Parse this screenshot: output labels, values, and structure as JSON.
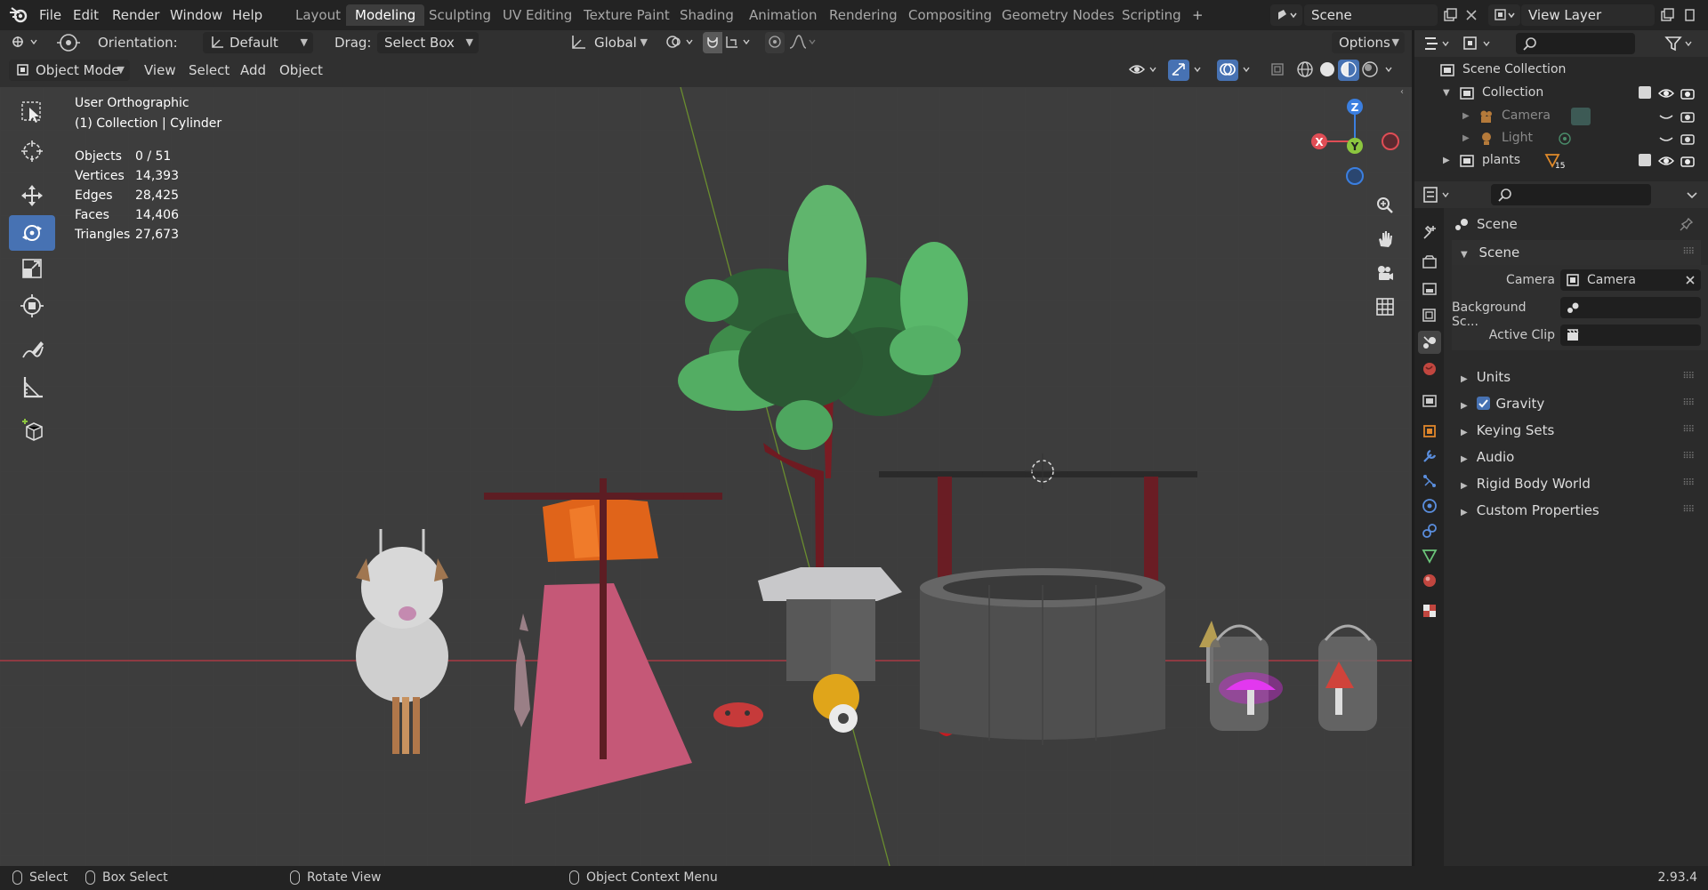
{
  "menu": {
    "file": "File",
    "edit": "Edit",
    "render": "Render",
    "window": "Window",
    "help": "Help"
  },
  "workspaces": [
    "Layout",
    "Modeling",
    "Sculpting",
    "UV Editing",
    "Texture Paint",
    "Shading",
    "Animation",
    "Rendering",
    "Compositing",
    "Geometry Nodes",
    "Scripting"
  ],
  "active_workspace": "Modeling",
  "add_workspace": "+",
  "scene_field": "Scene",
  "view_layer_field": "View Layer",
  "header": {
    "orientation_label": "Orientation:",
    "orientation_value": "Default",
    "drag_label": "Drag:",
    "drag_value": "Select Box",
    "transform_orientation": "Global",
    "options": "Options",
    "mode": "Object Mode",
    "view": "View",
    "select": "Select",
    "add": "Add",
    "object": "Object"
  },
  "overlay_text": {
    "view_name": "User Orthographic",
    "collection_info": "(1) Collection | Cylinder",
    "stats": [
      {
        "label": "Objects",
        "value": "0 / 51"
      },
      {
        "label": "Vertices",
        "value": "14,393"
      },
      {
        "label": "Edges",
        "value": "28,425"
      },
      {
        "label": "Faces",
        "value": "14,406"
      },
      {
        "label": "Triangles",
        "value": "27,673"
      }
    ]
  },
  "gizmo": {
    "z": "Z",
    "y": "Y",
    "x": "X"
  },
  "outliner": {
    "scene_collection": "Scene Collection",
    "items": [
      {
        "name": "Collection"
      },
      {
        "name": "Camera"
      },
      {
        "name": "Light"
      },
      {
        "name": "plants",
        "badge": "15"
      }
    ]
  },
  "properties": {
    "scene_header": "Scene",
    "panel_title": "Scene",
    "camera_label": "Camera",
    "camera_value": "Camera",
    "background_label": "Background Sc...",
    "active_clip_label": "Active Clip",
    "sections": [
      "Units",
      "Gravity",
      "Keying Sets",
      "Audio",
      "Rigid Body World",
      "Custom Properties"
    ],
    "gravity_checked": true
  },
  "statusbar": {
    "select": "Select",
    "box_select": "Box Select",
    "rotate_view": "Rotate View",
    "context_menu": "Object Context Menu",
    "version": "2.93.4"
  },
  "colors": {
    "accent": "#4772b3",
    "x_axis": "#e04d55",
    "y_axis": "#8cc63f",
    "z_axis": "#3b7fe0"
  }
}
